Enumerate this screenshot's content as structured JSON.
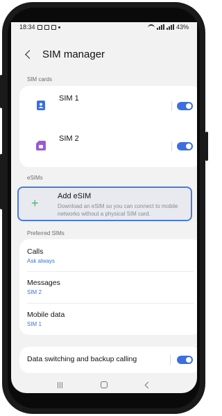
{
  "status_bar": {
    "time": "18:34",
    "battery": "43%"
  },
  "header": {
    "title": "SIM manager",
    "back_icon": "chevron-left-icon"
  },
  "sim_cards": {
    "section_label": "SIM cards",
    "items": [
      {
        "label": "SIM 1",
        "icon": "sim-person-icon",
        "icon_color": "#3d6fe0",
        "enabled": true
      },
      {
        "label": "SIM 2",
        "icon": "sim-card-icon",
        "icon_color": "#9b59d6",
        "enabled": true
      }
    ]
  },
  "esims": {
    "section_label": "eSIMs",
    "add_title": "Add eSIM",
    "add_description": "Download an eSIM so you can connect to mobile networks without a physical SIM card.",
    "add_icon": "plus-icon"
  },
  "preferred_sims": {
    "section_label": "Preferred SIMs",
    "items": [
      {
        "title": "Calls",
        "value": "Ask always"
      },
      {
        "title": "Messages",
        "value": "SIM 2"
      },
      {
        "title": "Mobile data",
        "value": "SIM 1"
      }
    ]
  },
  "data_switching": {
    "label": "Data switching and backup calling",
    "enabled": true
  },
  "colors": {
    "accent": "#3d6fe0",
    "background": "#f2f2f2",
    "card": "#ffffff",
    "highlight_border": "#4a7ae0",
    "plus_green": "#4fb06b"
  }
}
